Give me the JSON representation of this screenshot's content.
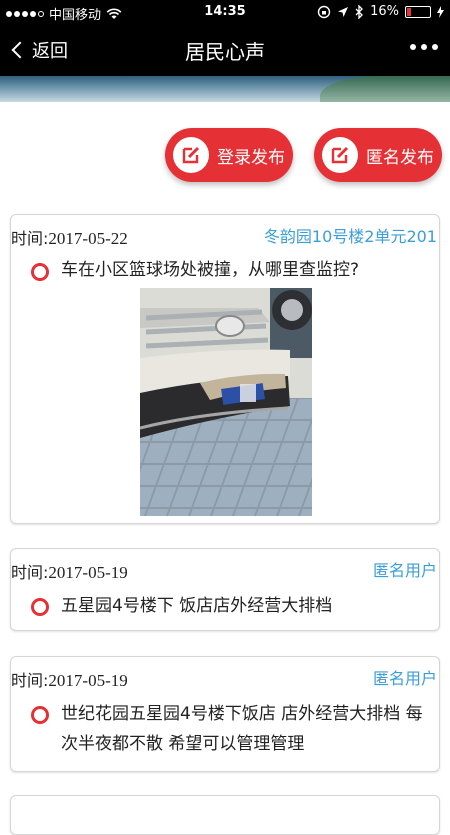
{
  "status": {
    "carrier": "中国移动",
    "time": "14:35",
    "battery": "16%",
    "battery_level": 0.16,
    "battery_color": "#e8323c"
  },
  "nav": {
    "back_label": "返回",
    "title": "居民心声"
  },
  "actions": {
    "login_post": "登录发布",
    "anon_post": "匿名发布",
    "accent": "#e53035"
  },
  "posts": [
    {
      "time_label": "时间:",
      "time": "2017-05-22",
      "user": "冬韵园10号楼2单元201",
      "content": "车在小区篮球场处被撞，从哪里查监控?"
    },
    {
      "time_label": "时间:",
      "time": "2017-05-19",
      "user": "匿名用户",
      "content": "五星园4号楼下 饭店店外经营大排档"
    },
    {
      "time_label": "时间:",
      "time": "2017-05-19",
      "user": "匿名用户",
      "content": "世纪花园五星园4号楼下饭店 店外经营大排档 每次半夜都不散 希望可以管理管理"
    }
  ],
  "user_color": "#3a9fd8"
}
